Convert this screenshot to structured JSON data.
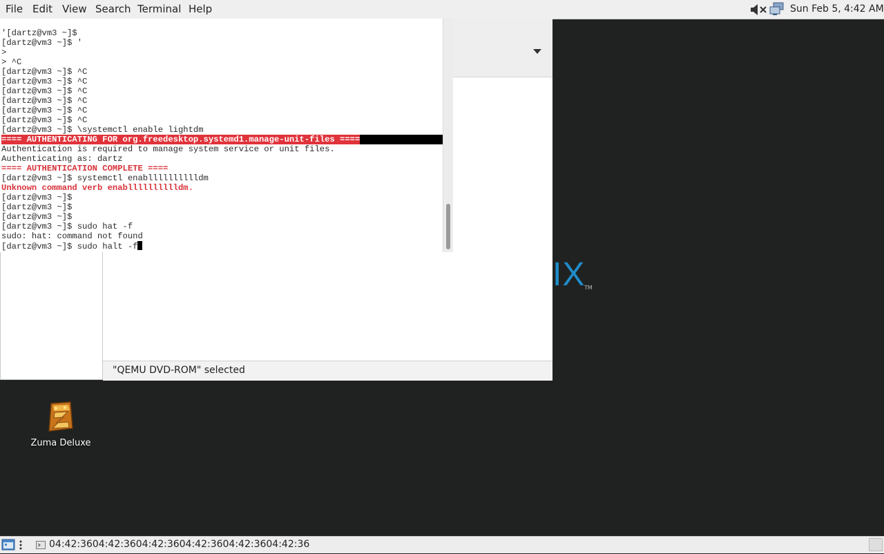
{
  "menubar": {
    "items": [
      "File",
      "Edit",
      "View",
      "Search",
      "Terminal",
      "Help"
    ],
    "clock": "Sun Feb  5,  4:42 AM"
  },
  "terminal": {
    "lines": [
      {
        "text": "'[dartz@vm3 ~]$",
        "style": "normal"
      },
      {
        "text": "[dartz@vm3 ~]$ '",
        "style": "normal"
      },
      {
        "text": ">",
        "style": "normal"
      },
      {
        "text": "> ^C",
        "style": "normal"
      },
      {
        "text": "[dartz@vm3 ~]$ ^C",
        "style": "normal"
      },
      {
        "text": "[dartz@vm3 ~]$ ^C",
        "style": "normal"
      },
      {
        "text": "[dartz@vm3 ~]$ ^C",
        "style": "normal"
      },
      {
        "text": "[dartz@vm3 ~]$ ^C",
        "style": "normal"
      },
      {
        "text": "[dartz@vm3 ~]$ ^C",
        "style": "normal"
      },
      {
        "text": "[dartz@vm3 ~]$ ^C",
        "style": "normal"
      },
      {
        "text": "[dartz@vm3 ~]$ \\systemctl enable lightdm",
        "style": "normal"
      },
      {
        "text": "==== AUTHENTICATING FOR org.freedesktop.systemd1.manage-unit-files ====",
        "style": "highlight"
      },
      {
        "text": "Authentication is required to manage system service or unit files.",
        "style": "normal"
      },
      {
        "text": "Authenticating as: dartz",
        "style": "normal"
      },
      {
        "text": "==== AUTHENTICATION COMPLETE ====",
        "style": "red"
      },
      {
        "text": "[dartz@vm3 ~]$ systemctl enablllllllllldm",
        "style": "normal"
      },
      {
        "text": "Unknown command verb enablllllllllldm.",
        "style": "red"
      },
      {
        "text": "[dartz@vm3 ~]$",
        "style": "normal"
      },
      {
        "text": "[dartz@vm3 ~]$",
        "style": "normal"
      },
      {
        "text": "[dartz@vm3 ~]$",
        "style": "normal"
      },
      {
        "text": "[dartz@vm3 ~]$ sudo hat -f",
        "style": "normal"
      },
      {
        "text": "sudo: hat: command not found",
        "style": "normal"
      },
      {
        "text": "[dartz@vm3 ~]$ sudo halt -f",
        "style": "cursor"
      }
    ]
  },
  "file_manager": {
    "status_text": "\"QEMU DVD-ROM\" selected"
  },
  "desktop": {
    "brand_fragment": "IX",
    "brand_tm": "TM",
    "icons": [
      {
        "label": "Zuma Deluxe"
      }
    ]
  },
  "taskbar": {
    "task_label": "04:42:3604:42:3604:42:3604:42:3604:42:3604:42:36"
  },
  "colors": {
    "desktop_bg": "#202221",
    "auth_highlight": "#e0333b",
    "error_text": "#d8333b",
    "brand_blue": "#1f8cc9"
  }
}
